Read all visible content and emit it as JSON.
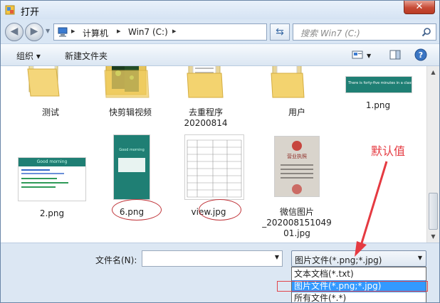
{
  "window": {
    "title": "打开",
    "close_label": "✕"
  },
  "address": {
    "crumbs": [
      "计算机",
      "Win7 (C:)"
    ],
    "search_placeholder": "搜索 Win7 (C:)"
  },
  "toolbar": {
    "organize": "组织 ▾",
    "new_folder": "新建文件夹"
  },
  "files": [
    {
      "name": "测试",
      "kind": "folder"
    },
    {
      "name": "快剪辑视频",
      "kind": "folder"
    },
    {
      "name": "去重程序\n20200814",
      "kind": "folder"
    },
    {
      "name": "用户",
      "kind": "folder"
    },
    {
      "name": "1.png",
      "kind": "image"
    },
    {
      "name": "2.png",
      "kind": "image"
    },
    {
      "name": "6.png",
      "kind": "image"
    },
    {
      "name": "view.jpg",
      "kind": "image"
    },
    {
      "name": "微信图片\n_202008151049\n01.jpg",
      "kind": "image"
    }
  ],
  "thumb_text": {
    "png1": "There is forty-five minutes in a class.",
    "png2_header": "Good morning",
    "png6_header": "Good morning",
    "cert": "营业执照"
  },
  "bottom": {
    "filename_label": "文件名(N):",
    "filename_value": "",
    "filetype_selected": "图片文件(*.png;*.jpg)",
    "filetype_options": [
      "文本文档(*.txt)",
      "图片文件(*.png;*.jpg)",
      "所有文件(*.*)"
    ]
  },
  "annotation": "默认值",
  "colors": {
    "teal": "#1f7f74",
    "accent": "#3399ff",
    "annot": "#e53a41"
  }
}
